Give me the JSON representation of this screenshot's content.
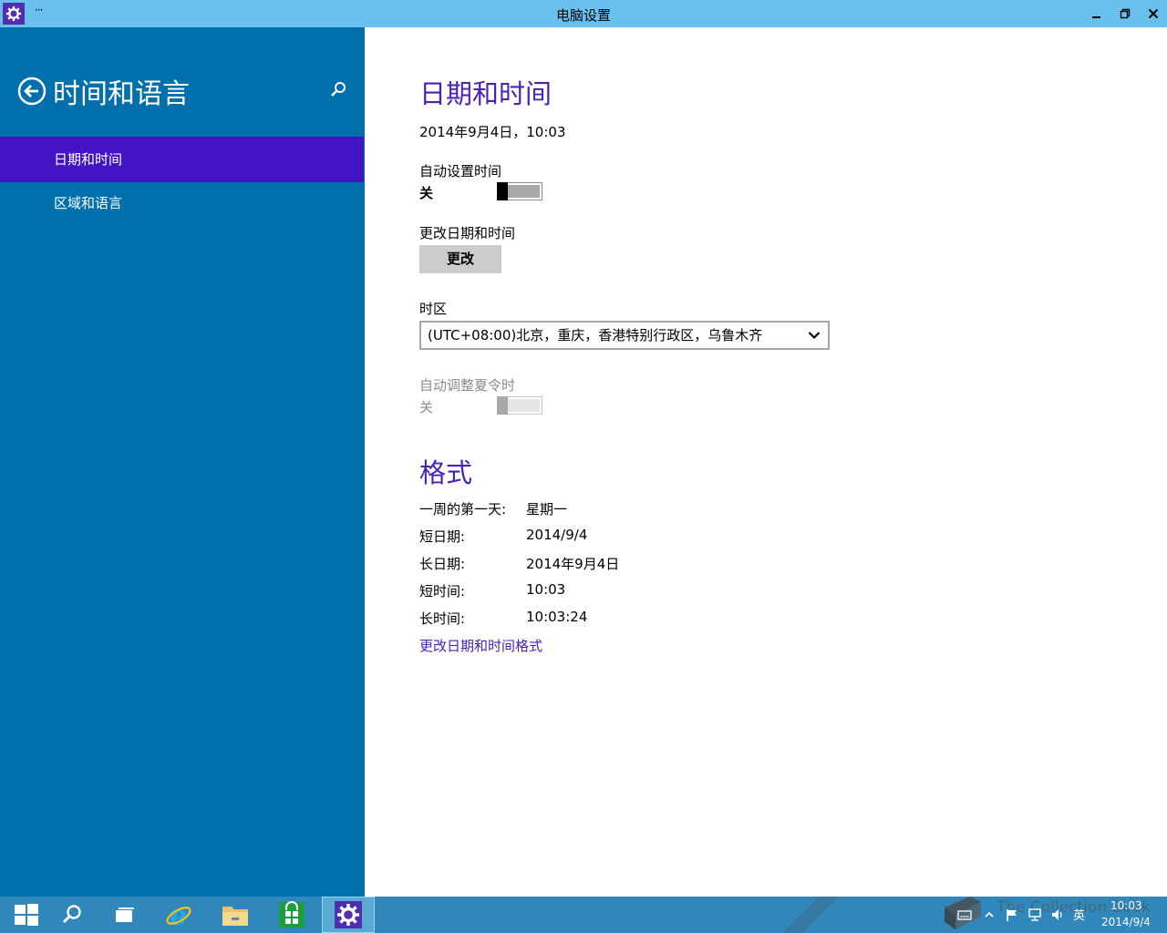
{
  "window": {
    "title": "电脑设置",
    "menu_glyph": "···"
  },
  "sidebar": {
    "title": "时间和语言",
    "items": [
      {
        "label": "日期和时间",
        "selected": true
      },
      {
        "label": "区域和语言",
        "selected": false
      }
    ]
  },
  "datetime": {
    "heading": "日期和时间",
    "current": "2014年9月4日，10:03",
    "auto_time_label": "自动设置时间",
    "auto_time_state": "关",
    "change_label": "更改日期和时间",
    "change_button": "更改",
    "timezone_label": "时区",
    "timezone_value": "(UTC+08:00)北京，重庆，香港特别行政区，乌鲁木齐",
    "dst_label": "自动调整夏令时",
    "dst_state": "关"
  },
  "format": {
    "heading": "格式",
    "rows": [
      {
        "label": "一周的第一天:",
        "value": "星期一"
      },
      {
        "label": "短日期:",
        "value": "2014/9/4"
      },
      {
        "label": "长日期:",
        "value": "2014年9月4日"
      },
      {
        "label": "短时间:",
        "value": "10:03"
      },
      {
        "label": "长时间:",
        "value": "10:03:24"
      }
    ],
    "link": "更改日期和时间格式"
  },
  "taskbar": {
    "ime": "英",
    "clock_time": "10:03",
    "clock_date": "2014/9/4",
    "watermark": "The Collection Book"
  },
  "colors": {
    "sidebar": "#0070ac",
    "selected_nav": "#4314c3",
    "accent": "#4a22b6",
    "titlebar": "#6ac0ec",
    "taskbar": "#2f87bb"
  }
}
